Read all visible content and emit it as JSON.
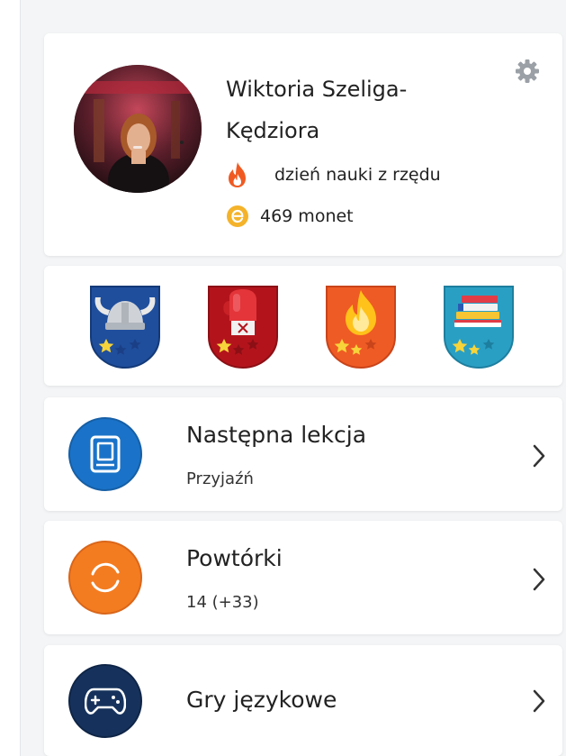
{
  "profile": {
    "name_line1": "Wiktoria Szeliga-",
    "name_line2": "Kędziora",
    "streak_text": "dzień nauki z rzędu",
    "coins_text": "469 monet",
    "avatar_alt": "Wiktoria Szeliga-Kędziora"
  },
  "badges": [
    {
      "icon": "viking-helmet-icon",
      "color": "#1f4e9c",
      "stars_filled": 1
    },
    {
      "icon": "boxing-glove-icon",
      "color": "#b3141c",
      "stars_filled": 1
    },
    {
      "icon": "fire-icon",
      "color": "#ef5b24",
      "stars_filled": 2
    },
    {
      "icon": "books-icon",
      "color": "#2a9fc4",
      "stars_filled": 2
    }
  ],
  "menu": {
    "next_lesson": {
      "title": "Następna lekcja",
      "subtitle": "Przyjaźń"
    },
    "reviews": {
      "title": "Powtórki",
      "subtitle": "14 (+33)"
    },
    "games": {
      "title": "Gry językowe"
    }
  },
  "colors": {
    "lesson_blue": "#1a73c8",
    "review_orange": "#f47c20",
    "games_navy": "#16325c",
    "coin_yellow": "#f4b32a",
    "flame_orange": "#f05a22"
  }
}
